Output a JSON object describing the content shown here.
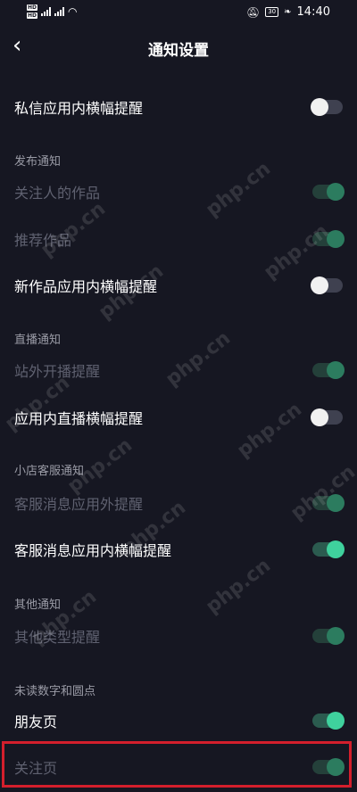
{
  "status_bar": {
    "left_badges": [
      "HD",
      "HD"
    ],
    "time": "14:40",
    "battery": "30"
  },
  "header": {
    "back_icon": "chevron-left-icon",
    "title": "通知设置"
  },
  "items": {
    "private_msg_banner": {
      "label": "私信应用内横幅提醒",
      "state": "off"
    },
    "publish_section": "发布通知",
    "followed_works": {
      "label": "关注人的作品",
      "state": "on-disabled"
    },
    "recommended_works": {
      "label": "推荐作品",
      "state": "on-disabled"
    },
    "new_works_banner": {
      "label": "新作品应用内横幅提醒",
      "state": "off"
    },
    "live_section": "直播通知",
    "offsite_live": {
      "label": "站外开播提醒",
      "state": "on-disabled"
    },
    "in_app_live_banner": {
      "label": "应用内直播横幅提醒",
      "state": "off"
    },
    "shop_section": "小店客服通知",
    "cs_msg_outside": {
      "label": "客服消息应用外提醒",
      "state": "on-disabled"
    },
    "cs_msg_banner": {
      "label": "客服消息应用内横幅提醒",
      "state": "on"
    },
    "other_section": "其他通知",
    "other_types": {
      "label": "其他类型提醒",
      "state": "on-disabled"
    },
    "unread_section": "未读数字和圆点",
    "friends_page": {
      "label": "朋友页",
      "state": "on"
    },
    "following_page": {
      "label": "关注页",
      "state": "on-disabled"
    }
  },
  "watermark": "php.cn",
  "colors": {
    "background": "#161722",
    "toggle_on_knob": "#3fd19d",
    "highlight_border": "#d41f2c"
  }
}
